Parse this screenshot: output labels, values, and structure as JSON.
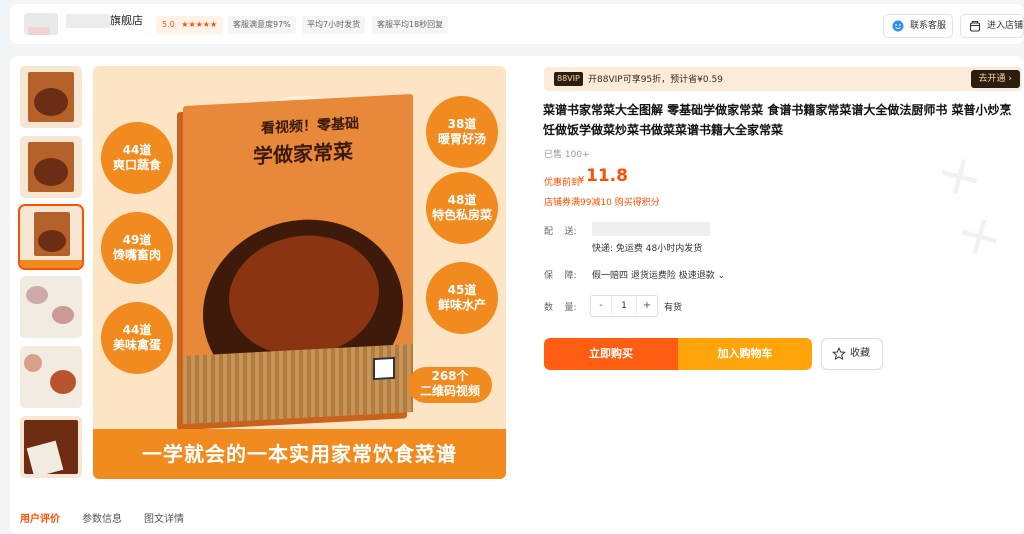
{
  "store": {
    "name_suffix": "旗舰店",
    "rating": "5.0",
    "stars": "★★★★★",
    "stats": [
      "客服满意度97%",
      "平均7小时发货",
      "客服平均18秒回复"
    ],
    "contact_label": "联系客服",
    "enter_label": "进入店铺"
  },
  "hero": {
    "cover_small_title": "看视频！零基础",
    "cover_title": "学做家常菜",
    "bubbles": [
      "44道\n爽口蔬食",
      "49道\n馋嘴畜肉",
      "44道\n美味禽蛋",
      "38道\n暖胃好汤",
      "48道\n特色私房菜",
      "45道\n鲜味水产"
    ],
    "qr_bubble": "268个\n二维码视频",
    "banner": "一学就会的一本实用家常饮食菜谱"
  },
  "vip": {
    "tag": "88VIP",
    "text": "开88VIP可享95折，预计省¥0.59",
    "button": "去开通 ›"
  },
  "product": {
    "title": "菜谱书家常菜大全图解 零基础学做家常菜 食谱书籍家常菜谱大全做法厨师书 菜普小炒烹饪做饭学做菜炒菜书做菜菜谱书籍大全家常菜",
    "sold": "已售 100+",
    "price_label": "优惠前到",
    "price_symbol": "¥",
    "price": "11.8",
    "coupon": "店铺券满99减10 购买得积分"
  },
  "rows": {
    "delivery_label": "配    送:",
    "shipping": "快递: 免运费   48小时内发货",
    "guarantee_label": "保    障:",
    "guarantee": "假一赔四 退货运费险 极速退款 ⌄",
    "quantity_label": "数    量:",
    "quantity": "1",
    "minus": "-",
    "plus": "+",
    "stock": "有货"
  },
  "actions": {
    "buy_now": "立即购买",
    "add_to_cart": "加入购物车",
    "favorite": "收藏"
  },
  "tabs": [
    "用户评价",
    "参数信息",
    "图文详情"
  ],
  "colors": {
    "accent": "#ff5000",
    "buy": "#ff5e12",
    "cart": "#ffa50b",
    "orange_image": "#f28b1f"
  }
}
